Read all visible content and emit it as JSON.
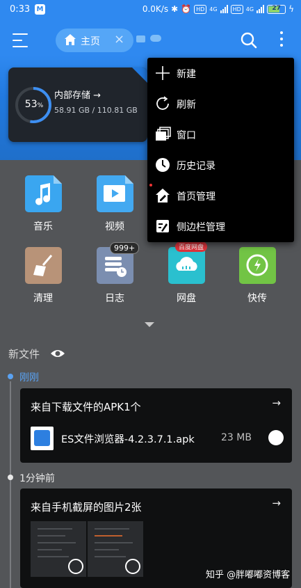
{
  "status_bar": {
    "time": "0:33",
    "speed": "0.0K/s",
    "volte1": "HD",
    "volte2": "HD",
    "net1": "4G",
    "net2": "4G",
    "battery": "27"
  },
  "toolbar": {
    "tab_label": "主页"
  },
  "storage": {
    "percent": "53",
    "percent_sign": "%",
    "title": "内部存储 →",
    "size": "58.91 GB / 110.81 GB",
    "used_fraction": 0.53
  },
  "grid": [
    {
      "label": "音乐",
      "color": "#3aa6f0",
      "icon": "music-icon"
    },
    {
      "label": "视频",
      "color": "#43a9f1",
      "icon": "video-icon"
    },
    {
      "label": "清理",
      "color": "#b89378",
      "icon": "broom-icon"
    },
    {
      "label": "日志",
      "color": "#7b8eb0",
      "icon": "log-icon",
      "badge": "999+"
    },
    {
      "label": "网盘",
      "color": "#2ac0cf",
      "icon": "cloud-drive-icon",
      "badge": "百度网盘"
    },
    {
      "label": "快传",
      "color": "#72c445",
      "icon": "transfer-icon"
    }
  ],
  "recent": {
    "title": "新文件",
    "group1": {
      "time": "刚刚",
      "card_title": "来自下载文件的APK1个",
      "file_name": "ES文件浏览器-4.2.3.7.1.apk",
      "file_size": "23 MB"
    },
    "group2": {
      "time": "1分钟前",
      "card_title": "来自手机截屏的图片2张"
    }
  },
  "popup_menu": [
    {
      "label": "新建",
      "icon": "plus-icon"
    },
    {
      "label": "刷新",
      "icon": "refresh-icon"
    },
    {
      "label": "窗口",
      "icon": "windows-icon"
    },
    {
      "label": "历史记录",
      "icon": "history-icon"
    },
    {
      "label": "首页管理",
      "icon": "home-manage-icon"
    },
    {
      "label": "侧边栏管理",
      "icon": "sidebar-manage-icon"
    }
  ],
  "watermark": "知乎 @胖嘟嘟资博客",
  "colors": {
    "accent": "#2f89f0",
    "timeline_active": "#5aa2f2",
    "badge_red": "#e0343c"
  }
}
